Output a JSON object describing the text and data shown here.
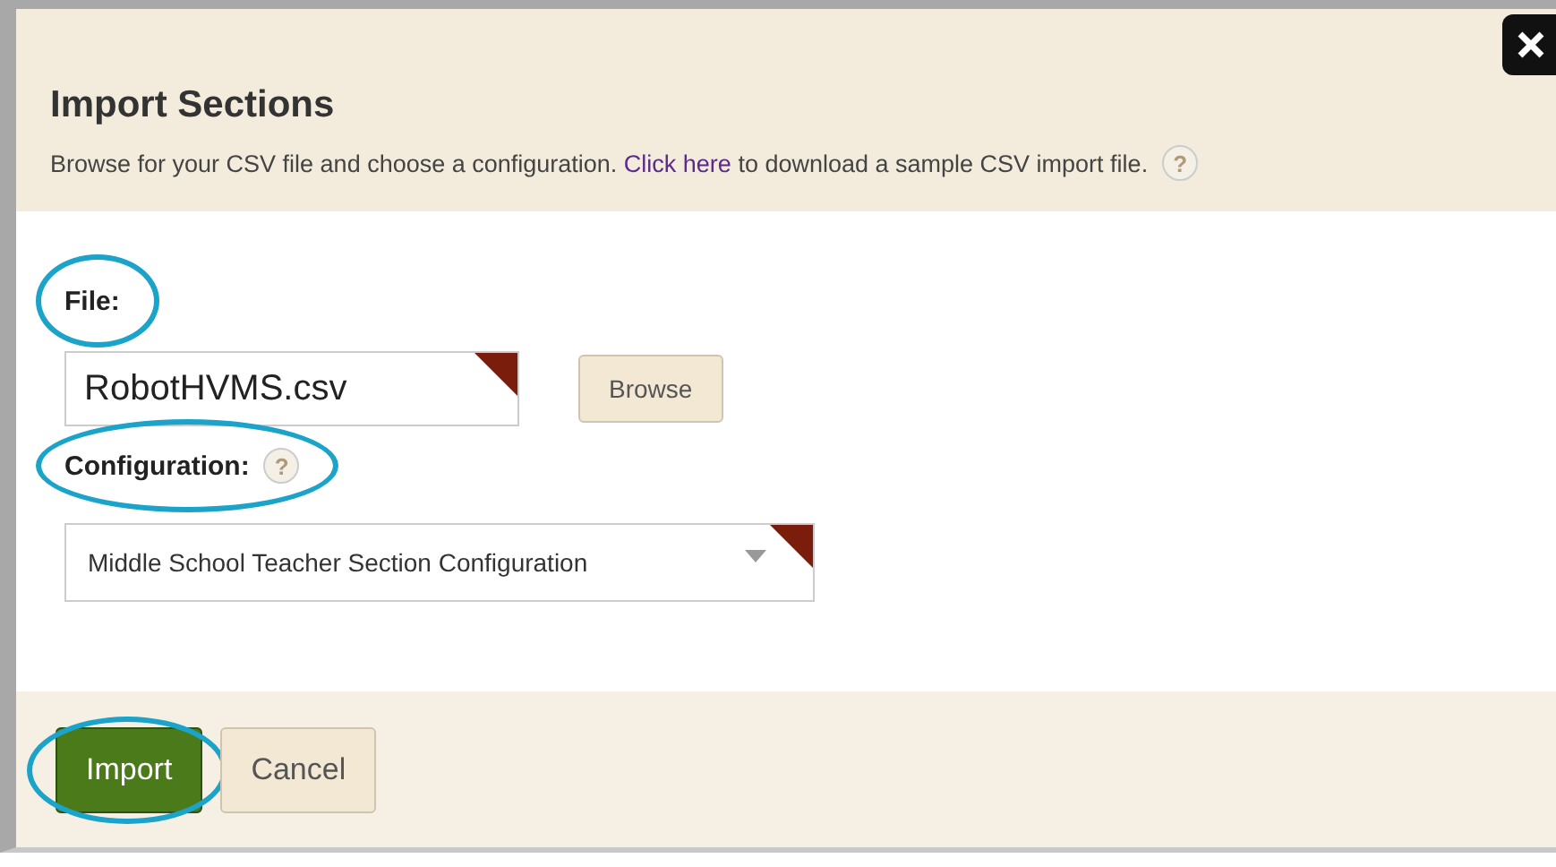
{
  "dialog": {
    "title": "Import Sections",
    "description": {
      "before": "Browse for your CSV file and choose a configuration.",
      "link": "Click here",
      "after": "to download a sample CSV import file."
    },
    "help": "?"
  },
  "fields": [
    {
      "kind": "file",
      "label": "File:",
      "value": "RobotHVMS.csv",
      "button": "Browse",
      "highlighted": true
    },
    {
      "kind": "select",
      "label": "Configuration:",
      "help": "?",
      "value": "Middle School Teacher Section Configuration",
      "highlighted": true
    }
  ],
  "buttons": [
    {
      "label": "Import",
      "kind": "primary",
      "highlighted": true
    },
    {
      "label": "Cancel",
      "kind": "secondary",
      "highlighted": false
    }
  ]
}
